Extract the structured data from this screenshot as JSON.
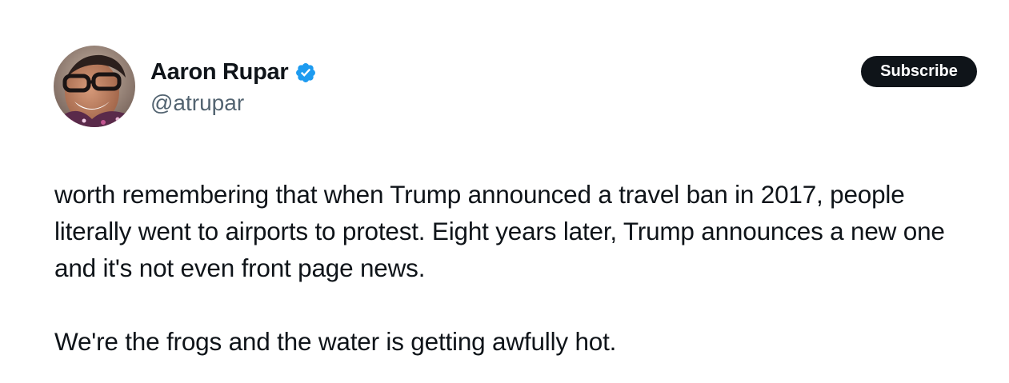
{
  "author": {
    "name": "Aaron Rupar",
    "handle": "@atrupar",
    "verified": true,
    "avatar_icon": "user-avatar-photo"
  },
  "actions": {
    "subscribe_label": "Subscribe"
  },
  "tweet": {
    "paragraphs": [
      "worth remembering that when Trump announced a travel ban in 2017, people literally went to airports to protest. Eight years later, Trump announces a new one and it's not even front page news.",
      "We're the frogs and the water is getting awfully hot."
    ]
  },
  "colors": {
    "text_primary": "#0f1419",
    "text_secondary": "#536471",
    "verified_blue": "#1d9bf0",
    "button_bg": "#0f1419",
    "button_text": "#ffffff"
  }
}
